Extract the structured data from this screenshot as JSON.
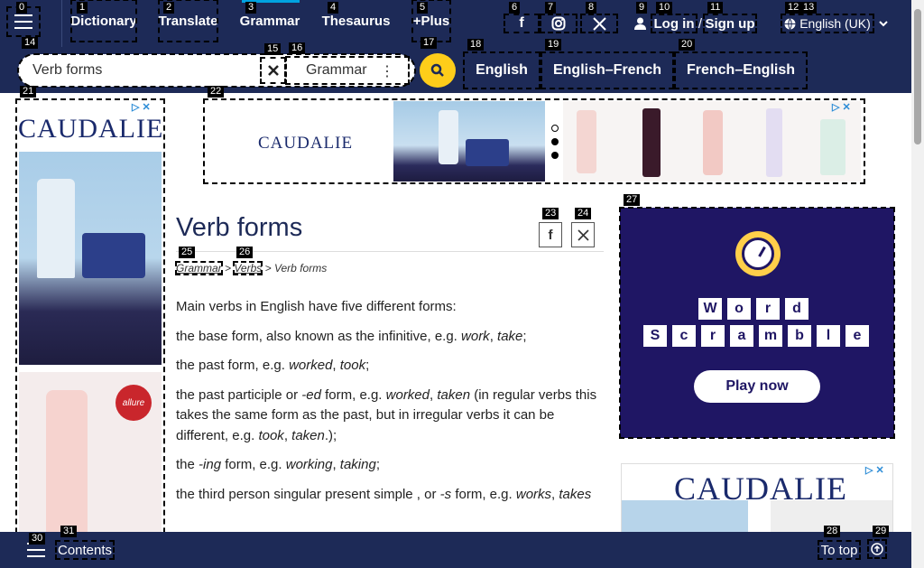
{
  "nav": {
    "items": [
      "Dictionary",
      "Translate",
      "Grammar",
      "Thesaurus",
      "+Plus"
    ],
    "login": "Log in",
    "slash": "/",
    "signup": "Sign up",
    "language": "English (UK)"
  },
  "search": {
    "value": "Verb forms",
    "dictionary": "Grammar",
    "directions": [
      "English",
      "English–French",
      "French–English"
    ]
  },
  "ads": {
    "brand": "CAUDALIE",
    "badge": "allure",
    "game_title": "Word Scramble",
    "game_letters_row1": [
      "W",
      "o",
      "r",
      "d"
    ],
    "game_letters_row2": [
      "S",
      "c",
      "r",
      "a",
      "m",
      "b",
      "l",
      "e"
    ],
    "play_label": "Play now"
  },
  "article": {
    "title": "Verb forms",
    "breadcrumb": [
      "Grammar",
      "Verbs",
      "Verb forms"
    ],
    "intro": "Main verbs in English have five different forms:",
    "p1_text": "the base form, also known as the infinitive, e.g. ",
    "p1_ex1": "work",
    "p1_ex2": "take",
    "p2_text": "the past form, e.g. ",
    "p2_ex1": "worked",
    "p2_ex2": "took",
    "p3_text": "the past participle or ",
    "p3_ed": "-ed",
    "p3_mid": " form, e.g. ",
    "p3_ex1": "worked",
    "p3_ex2": "taken",
    "p3_tail": " (in regular verbs this takes the same form as the past, but in irregular verbs it can be different, e.g. ",
    "p3_ex3": "took",
    "p3_ex4": "taken",
    "p3_end": ".);",
    "p4_text": "the ",
    "p4_ing": "-ing",
    "p4_mid": " form, e.g. ",
    "p4_ex1": "working",
    "p4_ex2": "taking",
    "p5_text": "the third person singular present simple , or ",
    "p5_s": "-s",
    "p5_mid": " form, e.g. ",
    "p5_ex1": "works",
    "p5_ex2": "takes"
  },
  "bottom": {
    "contents": "Contents",
    "to_top": "To top"
  },
  "badges": [
    "0",
    "1",
    "2",
    "3",
    "4",
    "5",
    "6",
    "7",
    "8",
    "9",
    "10",
    "11",
    "12",
    "13",
    "14",
    "15",
    "16",
    "17",
    "18",
    "19",
    "20",
    "21",
    "22",
    "23",
    "24",
    "25",
    "26",
    "27",
    "28",
    "29",
    "30",
    "31"
  ],
  "colors": {
    "nav_bg": "#1d2a57",
    "accent_yellow": "#fecd1a",
    "game_bg": "#1f1664"
  }
}
